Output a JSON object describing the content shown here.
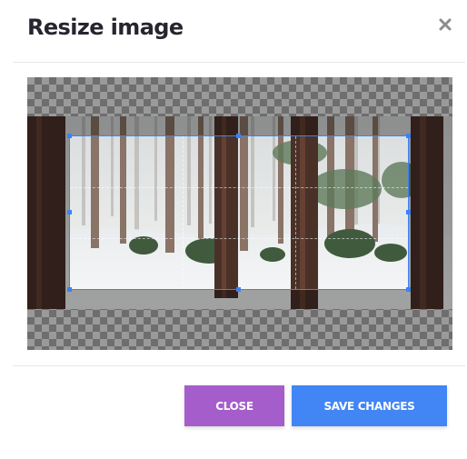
{
  "modal": {
    "title": "Resize image",
    "close_icon": "close-icon"
  },
  "cropper": {
    "image_subject": "snowy-forest-photo"
  },
  "footer": {
    "close_label": "CLOSE",
    "save_label": "SAVE CHANGES"
  },
  "colors": {
    "accent_blue": "#4285f4",
    "accent_purple": "#a45dcb",
    "crop_border": "#3b82f6",
    "title_text": "#262630"
  }
}
